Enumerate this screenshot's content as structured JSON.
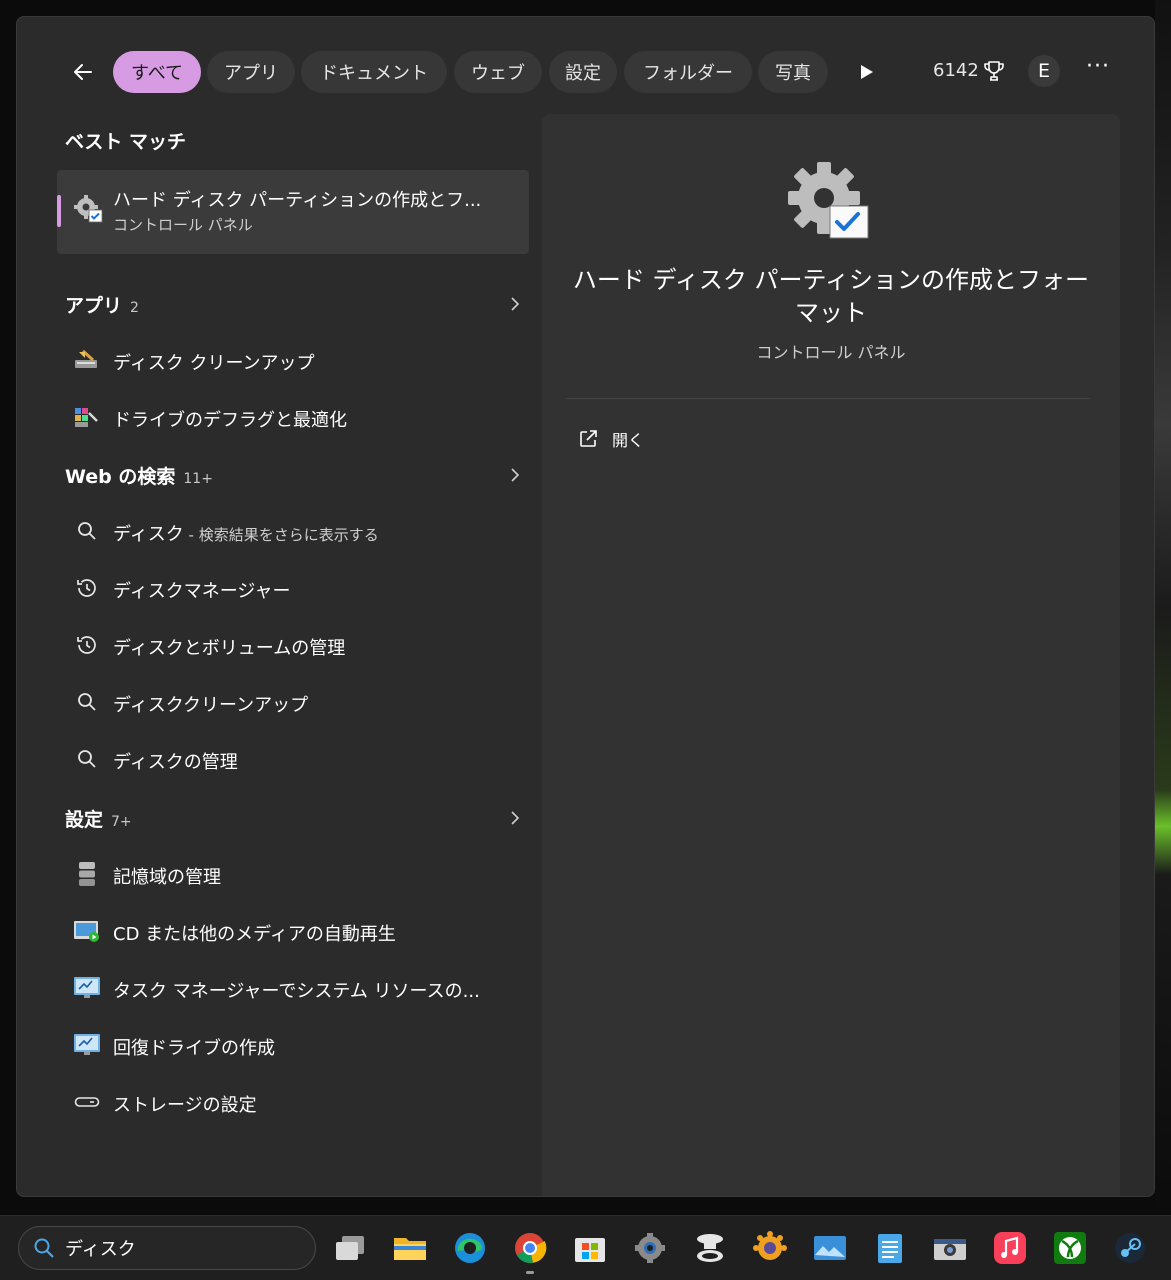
{
  "filters": {
    "chips": [
      "すべて",
      "アプリ",
      "ドキュメント",
      "ウェブ",
      "設定",
      "フォルダー",
      "写真"
    ],
    "active_index": 0,
    "score": "6142",
    "avatar_letter": "E",
    "more_glyph": "···"
  },
  "best_match": {
    "heading": "ベスト マッチ",
    "title": "ハード ディスク パーティションの作成とフ...",
    "subtitle": "コントロール パネル",
    "icon": "settings-gear-check-icon"
  },
  "sections": {
    "apps": {
      "heading": "アプリ",
      "count": "2",
      "items": [
        {
          "label": "ディスク クリーンアップ",
          "icon": "disk-cleanup-icon"
        },
        {
          "label": "ドライブのデフラグと最適化",
          "icon": "defrag-icon"
        }
      ]
    },
    "web": {
      "heading": "Web の検索",
      "count": "11+",
      "items": [
        {
          "label": "ディスク",
          "tail": " - 検索結果をさらに表示する",
          "icon": "search-icon"
        },
        {
          "label": "ディスクマネージャー",
          "icon": "history-icon"
        },
        {
          "label": "ディスクとボリュームの管理",
          "icon": "history-icon"
        },
        {
          "label": "ディスククリーンアップ",
          "icon": "search-icon"
        },
        {
          "label": "ディスクの管理",
          "icon": "search-icon"
        }
      ]
    },
    "settings": {
      "heading": "設定",
      "count": "7+",
      "items": [
        {
          "label": "記憶域の管理",
          "icon": "storage-spaces-icon"
        },
        {
          "label": "CD または他のメディアの自動再生",
          "icon": "autoplay-icon"
        },
        {
          "label": "タスク マネージャーでシステム リソースの...",
          "icon": "monitor-icon"
        },
        {
          "label": "回復ドライブの作成",
          "icon": "monitor-icon"
        },
        {
          "label": "ストレージの設定",
          "icon": "drive-icon"
        }
      ]
    }
  },
  "detail": {
    "title": "ハード ディスク パーティションの作成とフォーマット",
    "subtitle": "コントロール パネル",
    "open_label": "開く"
  },
  "taskbar": {
    "search_text": "ディスク",
    "apps": [
      "task-view-icon",
      "file-explorer-icon",
      "edge-icon",
      "chrome-icon",
      "microsoft-store-icon",
      "settings-icon",
      "steam-like-app-icon",
      "vlc-like-app-icon",
      "photos-app-icon",
      "notepad-icon",
      "camera-icon",
      "apple-music-icon",
      "xbox-icon",
      "steam-icon"
    ]
  },
  "colors": {
    "accent": "#d69be3",
    "panel": "#2b2b2b",
    "detail": "#323232"
  }
}
